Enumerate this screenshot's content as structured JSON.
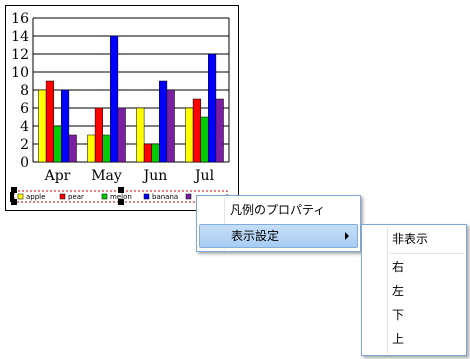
{
  "chart_data": {
    "type": "bar",
    "categories": [
      "Apr",
      "May",
      "Jun",
      "Jul"
    ],
    "series": [
      {
        "name": "apple",
        "color": "#ffff00",
        "values": [
          8,
          3,
          6,
          6
        ]
      },
      {
        "name": "pear",
        "color": "#ff0000",
        "values": [
          9,
          6,
          2,
          7
        ]
      },
      {
        "name": "melon",
        "color": "#00cc00",
        "values": [
          4,
          3,
          2,
          5
        ]
      },
      {
        "name": "banana",
        "color": "#0000ff",
        "values": [
          8,
          14,
          9,
          12
        ]
      },
      {
        "name": "",
        "color": "#7a1fa2",
        "values": [
          3,
          6,
          8,
          7
        ]
      }
    ],
    "ylim": [
      0,
      16
    ],
    "yticks": [
      "0",
      "2",
      "4",
      "6",
      "8",
      "10",
      "12",
      "14",
      "16"
    ],
    "grid": true,
    "legend_position": "bottom",
    "legend_selected": true
  },
  "context_menu": {
    "items": [
      {
        "label": "凡例のプロパティ"
      },
      {
        "label": "表示設定",
        "highlighted": true,
        "has_submenu": true
      }
    ]
  },
  "submenu": {
    "items": [
      {
        "label": "非表示"
      },
      {
        "label": "右"
      },
      {
        "label": "左"
      },
      {
        "label": "下"
      },
      {
        "label": "上"
      }
    ]
  }
}
